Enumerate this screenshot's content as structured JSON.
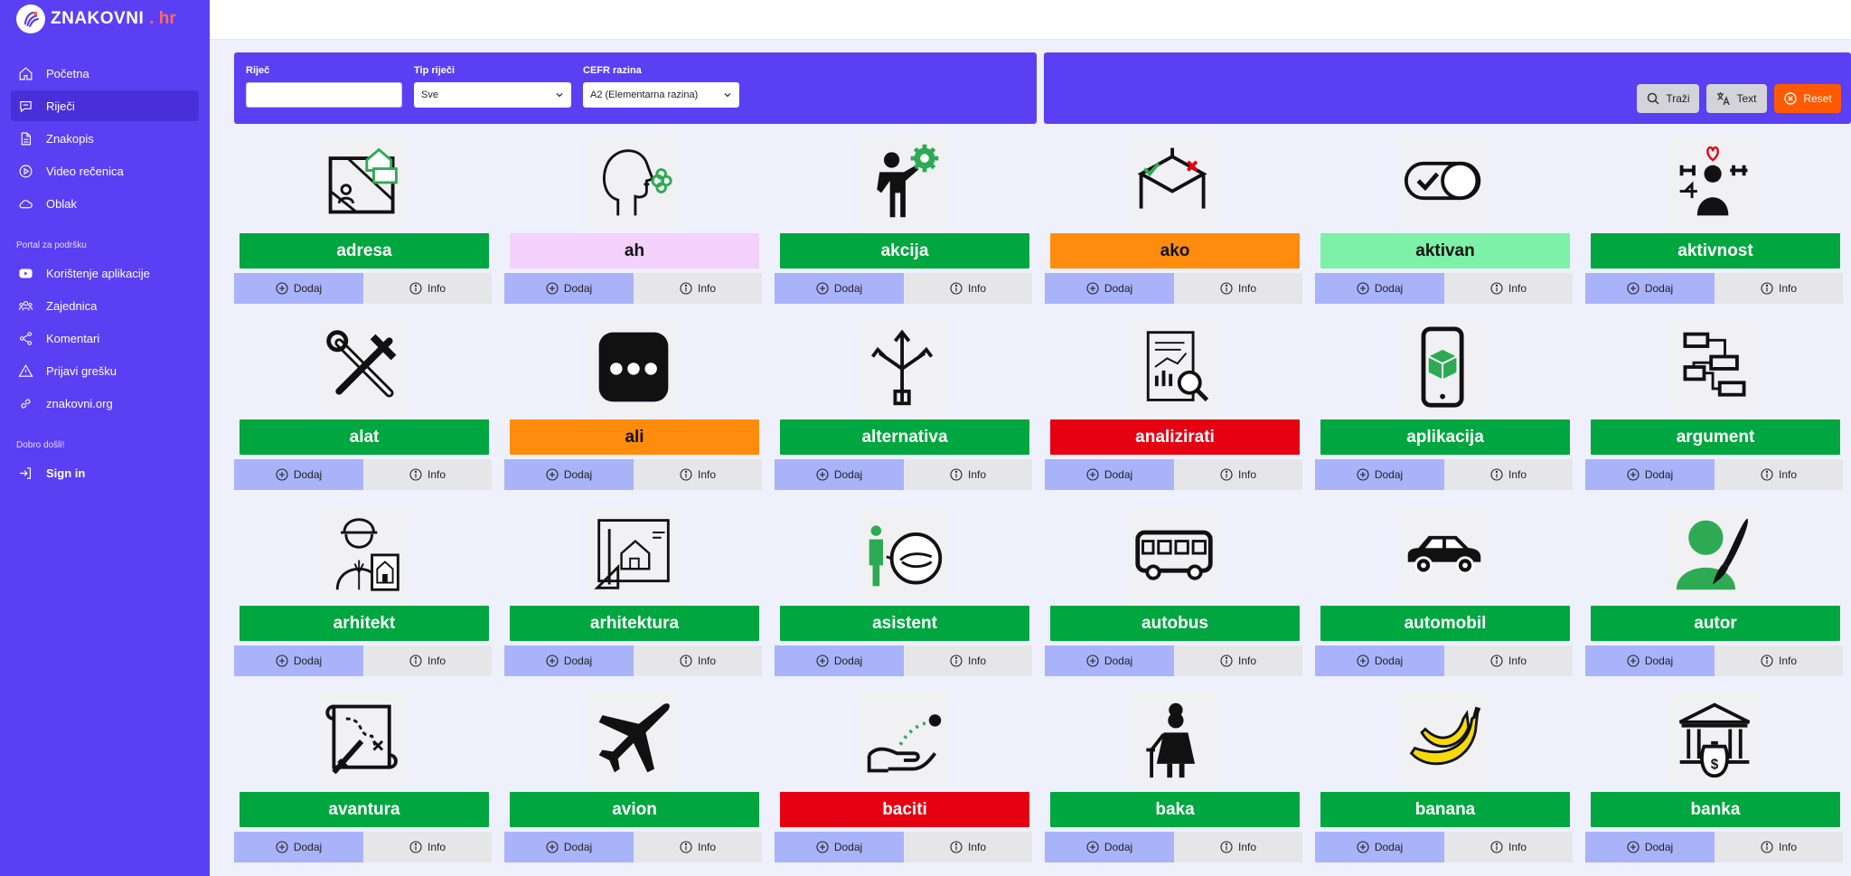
{
  "brand": {
    "name": "ZNAKOVNI",
    "tld": ". hr"
  },
  "nav": [
    {
      "label": "Početna",
      "icon": "home-icon"
    },
    {
      "label": "Riječi",
      "icon": "chat-icon"
    },
    {
      "label": "Znakopis",
      "icon": "document-icon"
    },
    {
      "label": "Video rečenica",
      "icon": "play-circle-icon"
    },
    {
      "label": "Oblak",
      "icon": "cloud-icon"
    }
  ],
  "support": {
    "heading": "Portal za podršku",
    "items": [
      {
        "label": "Korištenje aplikacije",
        "icon": "youtube-icon"
      },
      {
        "label": "Zajednica",
        "icon": "community-icon"
      },
      {
        "label": "Komentari",
        "icon": "share-icon"
      },
      {
        "label": "Prijavi grešku",
        "icon": "warning-icon"
      },
      {
        "label": "znakovni.org",
        "icon": "link-icon"
      }
    ]
  },
  "welcome": {
    "heading": "Dobro došli!",
    "signin": "Sign in"
  },
  "filters": {
    "word_label": "Riječ",
    "word_value": "",
    "type_label": "Tip riječi",
    "type_value": "Sve",
    "cefr_label": "CEFR razina",
    "cefr_value": "A2 (Elementarna razina)"
  },
  "actions": {
    "search": "Traži",
    "text": "Text",
    "reset": "Reset"
  },
  "card_buttons": {
    "add": "Dodaj",
    "info": "Info"
  },
  "colors": {
    "accent": "#5b3ff3",
    "green": "#00a63f",
    "orange": "#ff8c0d",
    "red": "#e50012",
    "pink": "#f3d1fb",
    "light_green": "#7df1a8"
  },
  "words": [
    {
      "word": "adresa",
      "color": "#00a63f",
      "text_color": "#ffffff",
      "icon": "address-map-icon"
    },
    {
      "word": "ah",
      "color": "#f3d1fb",
      "text_color": "#111111",
      "icon": "head-exhale-icon"
    },
    {
      "word": "akcija",
      "color": "#00a63f",
      "text_color": "#ffffff",
      "icon": "person-gear-icon"
    },
    {
      "word": "ako",
      "color": "#ff8c0d",
      "text_color": "#111111",
      "icon": "decision-icon"
    },
    {
      "word": "aktivan",
      "color": "#7df1a8",
      "text_color": "#111111",
      "icon": "toggle-check-icon"
    },
    {
      "word": "aktivnost",
      "color": "#00a63f",
      "text_color": "#ffffff",
      "icon": "person-activities-icon"
    },
    {
      "word": "alat",
      "color": "#00a63f",
      "text_color": "#ffffff",
      "icon": "tools-icon"
    },
    {
      "word": "ali",
      "color": "#ff8c0d",
      "text_color": "#111111",
      "icon": "ellipsis-icon"
    },
    {
      "word": "alternativa",
      "color": "#00a63f",
      "text_color": "#ffffff",
      "icon": "split-arrows-icon"
    },
    {
      "word": "analizirati",
      "color": "#e50012",
      "text_color": "#ffffff",
      "icon": "report-magnifier-icon"
    },
    {
      "word": "aplikacija",
      "color": "#00a63f",
      "text_color": "#ffffff",
      "icon": "phone-app-icon"
    },
    {
      "word": "argument",
      "color": "#00a63f",
      "text_color": "#ffffff",
      "icon": "flowchart-icon"
    },
    {
      "word": "arhitekt",
      "color": "#00a63f",
      "text_color": "#ffffff",
      "icon": "architect-icon"
    },
    {
      "word": "arhitektura",
      "color": "#00a63f",
      "text_color": "#ffffff",
      "icon": "blueprint-icon"
    },
    {
      "word": "asistent",
      "color": "#00a63f",
      "text_color": "#ffffff",
      "icon": "assistant-icon"
    },
    {
      "word": "autobus",
      "color": "#00a63f",
      "text_color": "#ffffff",
      "icon": "bus-icon"
    },
    {
      "word": "automobil",
      "color": "#00a63f",
      "text_color": "#ffffff",
      "icon": "car-icon"
    },
    {
      "word": "autor",
      "color": "#00a63f",
      "text_color": "#ffffff",
      "icon": "author-icon"
    },
    {
      "word": "avantura",
      "color": "#00a63f",
      "text_color": "#ffffff",
      "icon": "treasure-map-icon"
    },
    {
      "word": "avion",
      "color": "#00a63f",
      "text_color": "#ffffff",
      "icon": "airplane-icon"
    },
    {
      "word": "baciti",
      "color": "#e50012",
      "text_color": "#ffffff",
      "icon": "throw-icon"
    },
    {
      "word": "baka",
      "color": "#00a63f",
      "text_color": "#ffffff",
      "icon": "grandmother-icon"
    },
    {
      "word": "banana",
      "color": "#00a63f",
      "text_color": "#ffffff",
      "icon": "banana-icon"
    },
    {
      "word": "banka",
      "color": "#00a63f",
      "text_color": "#ffffff",
      "icon": "bank-icon"
    }
  ]
}
